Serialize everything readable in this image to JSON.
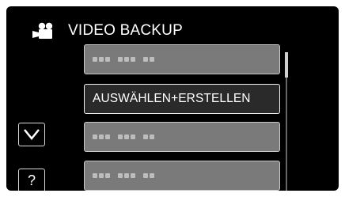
{
  "header": {
    "title": "VIDEO BACKUP",
    "icon": "video-camera-icon"
  },
  "menu": {
    "items": [
      {
        "label": "",
        "state": "disabled",
        "placeholder": "■■■ ■■■ ■■"
      },
      {
        "label": "AUSWÄHLEN+ERSTELLEN",
        "state": "selected"
      },
      {
        "label": "",
        "state": "disabled",
        "placeholder": "■■■ ■■■ ■■"
      },
      {
        "label": "",
        "state": "disabled",
        "placeholder": "■■■ ■■■ ■■"
      }
    ]
  },
  "side": {
    "down_icon": "chevron-down-icon",
    "help_label": "?"
  },
  "colors": {
    "screen_bg": "#000000",
    "button_bg": "#7a7a7a",
    "selected_bg": "#2a2a2a",
    "text": "#ffffff"
  }
}
